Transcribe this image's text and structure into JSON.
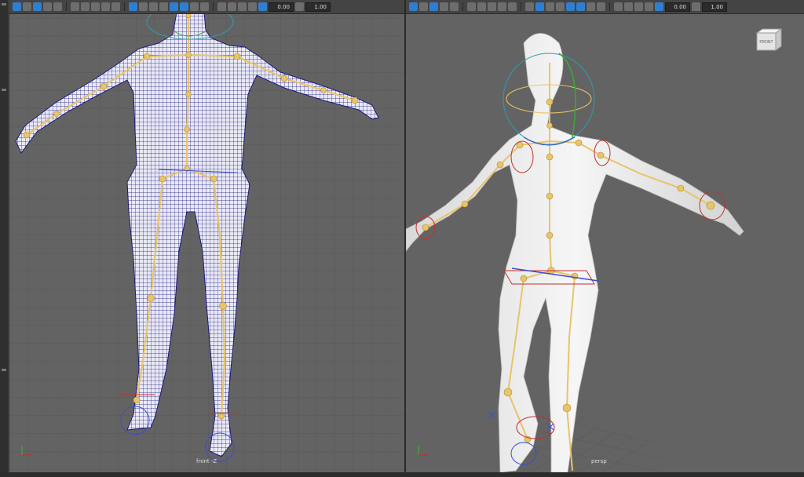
{
  "viewports": {
    "left": {
      "camera_label": "front -Z",
      "toolbar": {
        "field_a": "0.00",
        "field_b": "1.00"
      }
    },
    "right": {
      "camera_label": "persp",
      "view_cube_label": "FRONT",
      "toolbar": {
        "field_a": "0.00",
        "field_b": "1.00"
      }
    }
  },
  "colors": {
    "viewport_bg": "#636363",
    "joint": "#e8c46a",
    "wireframe": "#1d1a7a",
    "mesh": "#f1f1f1",
    "control_red": "#c23030",
    "control_green": "#3aa83a",
    "control_blue": "#3a4ed0",
    "active_button": "#2f7fd0"
  }
}
